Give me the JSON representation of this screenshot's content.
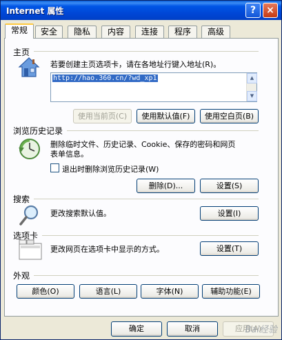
{
  "window": {
    "title": "Internet 属性",
    "help_label": "?",
    "close_label": "×"
  },
  "tabs": [
    {
      "label": "常规",
      "active": true
    },
    {
      "label": "安全",
      "active": false
    },
    {
      "label": "隐私",
      "active": false
    },
    {
      "label": "内容",
      "active": false
    },
    {
      "label": "连接",
      "active": false
    },
    {
      "label": "程序",
      "active": false
    },
    {
      "label": "高级",
      "active": false
    }
  ],
  "homepage": {
    "section_title": "主页",
    "description": "若要创建主页选项卡，请在各地址行键入地址(R)。",
    "url_value": "http://hao.360.cn/?wd_xp1",
    "use_current_label": "使用当前页(C)",
    "use_default_label": "使用默认值(F)",
    "use_blank_label": "使用空白页(B)"
  },
  "history": {
    "section_title": "浏览历史记录",
    "description_line1": "删除临时文件、历史记录、Cookie、保存的密码和网页",
    "description_line2": "表单信息。",
    "checkbox_label": "退出时删除浏览历史记录(W)",
    "delete_label": "删除(D)...",
    "settings_label": "设置(S)"
  },
  "search": {
    "section_title": "搜索",
    "description": "更改搜索默认值。",
    "settings_label": "设置(I)"
  },
  "tabs_section": {
    "section_title": "选项卡",
    "description": "更改网页在选项卡中显示的方式。",
    "settings_label": "设置(T)"
  },
  "appearance": {
    "section_title": "外观",
    "colors_label": "颜色(O)",
    "languages_label": "语言(L)",
    "fonts_label": "字体(N)",
    "accessibility_label": "辅助功能(E)"
  },
  "footer": {
    "ok_label": "确定",
    "cancel_label": "取消",
    "apply_label": "应用(A)"
  },
  "watermark": "Bai经验",
  "colors": {
    "titlebar": "#0055e5",
    "dialog_bg": "#ece9d8",
    "panel_bg": "#fcfcfe",
    "selection": "#316ac5"
  }
}
